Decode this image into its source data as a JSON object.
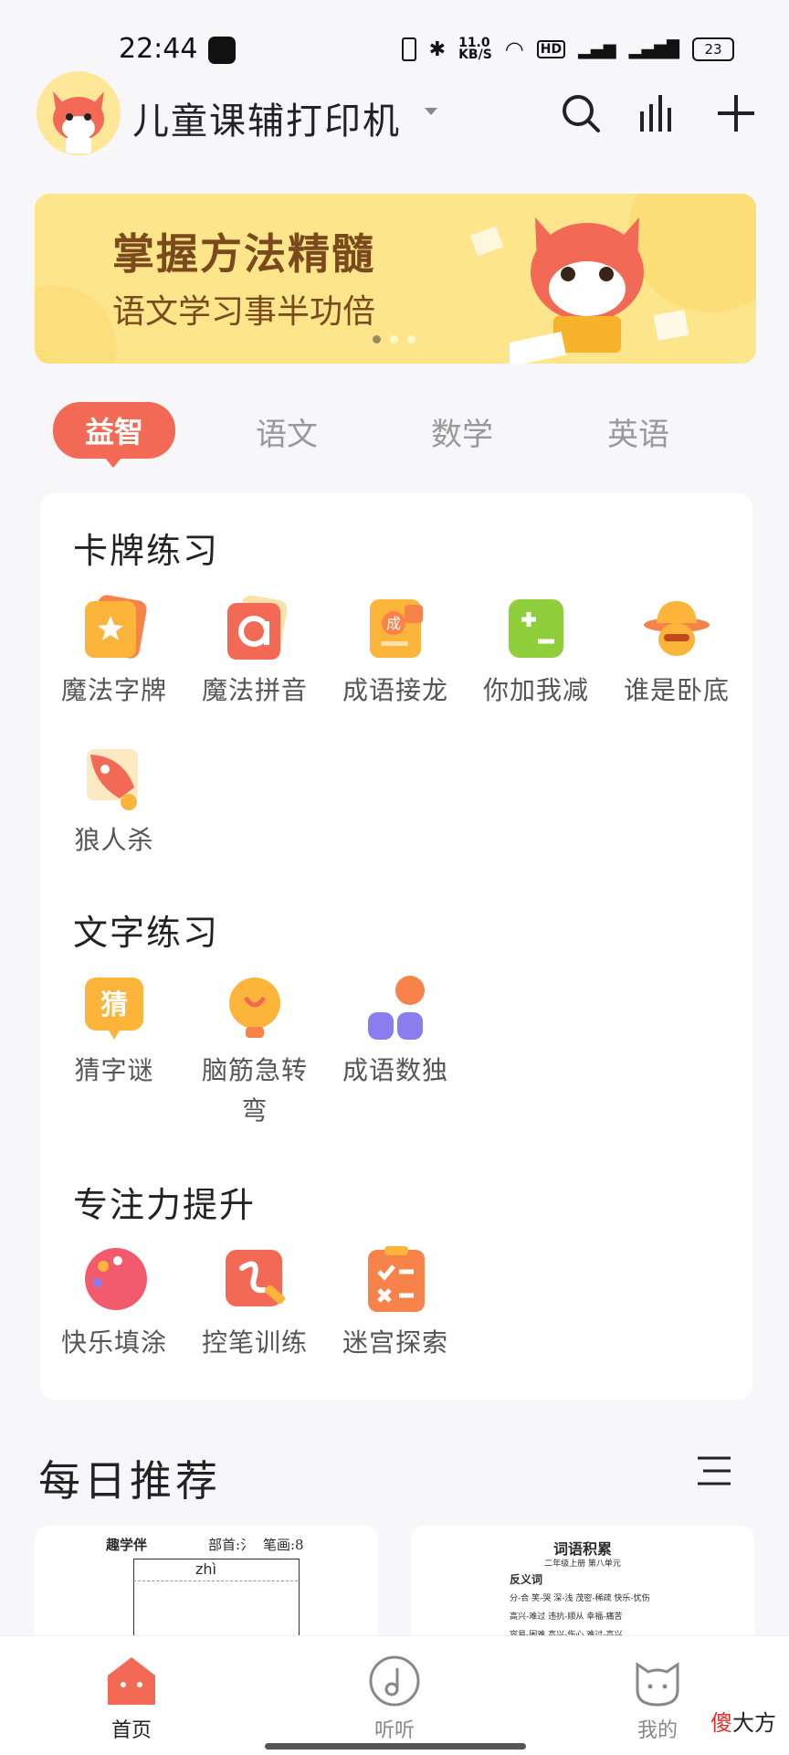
{
  "status": {
    "time": "22:44",
    "speed_top": "11.0",
    "speed_unit": "KB/S",
    "battery": "23"
  },
  "header": {
    "app_title": "儿童课辅打印机"
  },
  "banner": {
    "title": "掌握方法精髓",
    "subtitle": "语文学习事半功倍"
  },
  "tabs": [
    "益智",
    "语文",
    "数学",
    "英语"
  ],
  "sections": [
    {
      "title": "卡牌练习",
      "items": [
        "魔法字牌",
        "魔法拼音",
        "成语接龙",
        "你加我减",
        "谁是卧底",
        "狼人杀"
      ]
    },
    {
      "title": "文字练习",
      "items": [
        "猜字谜",
        "脑筋急转弯",
        "成语数独"
      ]
    },
    {
      "title": "专注力提升",
      "items": [
        "快乐填涂",
        "控笔训练",
        "迷宫探索"
      ]
    }
  ],
  "daily": {
    "title": "每日推荐",
    "card1": {
      "brand": "趣学伴",
      "bushou": "部首:氵",
      "bihua": "笔画:8",
      "pinyin": "zhì"
    },
    "card2": {
      "title": "词语积累",
      "subtitle": "二年级上册 第八单元",
      "heading": "反义词",
      "lines": [
        "分-合  笑-哭  深-浅  茂密-稀疏  快乐-忧伤",
        "高兴-难过  违抗-顺从  幸福-痛苦",
        "容易-困难  高兴-伤心  难过-高兴"
      ]
    }
  },
  "nav": [
    "首页",
    "听听",
    "我的"
  ],
  "watermark": {
    "a": "傻",
    "b": "大方"
  },
  "colors": {
    "accent": "#f26a55",
    "banner": "#fde58c"
  }
}
